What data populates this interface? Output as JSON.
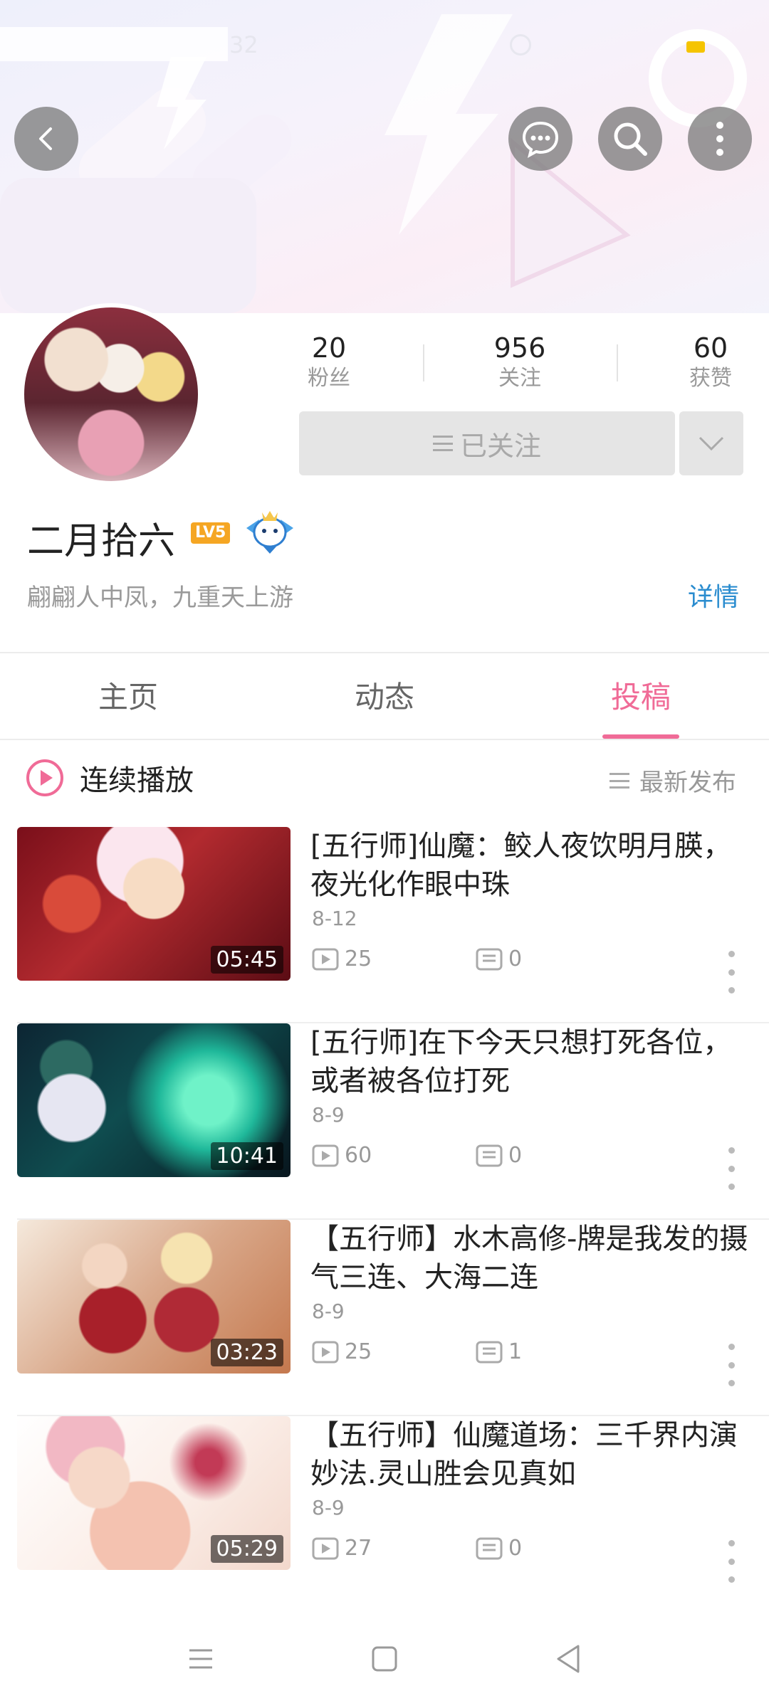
{
  "status_bar": {
    "time": "32"
  },
  "header": {
    "back_icon": "chevron-left-icon",
    "message_icon": "chat-bubble-icon",
    "search_icon": "search-icon",
    "more_icon": "more-vertical-icon"
  },
  "profile": {
    "stats": [
      {
        "value": "20",
        "label": "粉丝"
      },
      {
        "value": "956",
        "label": "关注"
      },
      {
        "value": "60",
        "label": "获赞"
      }
    ],
    "follow_button": "已关注",
    "username": "二月拾六",
    "level": "LV5",
    "bio": "翩翩人中凤，九重天上游",
    "detail_link": "详情"
  },
  "tabs": [
    {
      "label": "主页",
      "active": false
    },
    {
      "label": "动态",
      "active": false
    },
    {
      "label": "投稿",
      "active": true
    }
  ],
  "playlist": {
    "play_all": "连续播放",
    "sort": "最新发布"
  },
  "videos": [
    {
      "title": "[五行师]仙魔：鲛人夜饮明月朠，夜光化作眼中珠",
      "date": "8-12",
      "duration": "05:45",
      "plays": "25",
      "comments": "0"
    },
    {
      "title": "[五行师]在下今天只想打死各位，或者被各位打死",
      "date": "8-9",
      "duration": "10:41",
      "plays": "60",
      "comments": "0"
    },
    {
      "title": "【五行师】水木高修-牌是我发的摄气三连、大海二连",
      "date": "8-9",
      "duration": "03:23",
      "plays": "25",
      "comments": "1"
    },
    {
      "title": "【五行师】仙魔道场：三千界内演妙法.灵山胜会见真如",
      "date": "8-9",
      "duration": "05:29",
      "plays": "27",
      "comments": "0"
    }
  ],
  "theme": {
    "accent": "#f06b97",
    "link": "#2a8ccf"
  }
}
